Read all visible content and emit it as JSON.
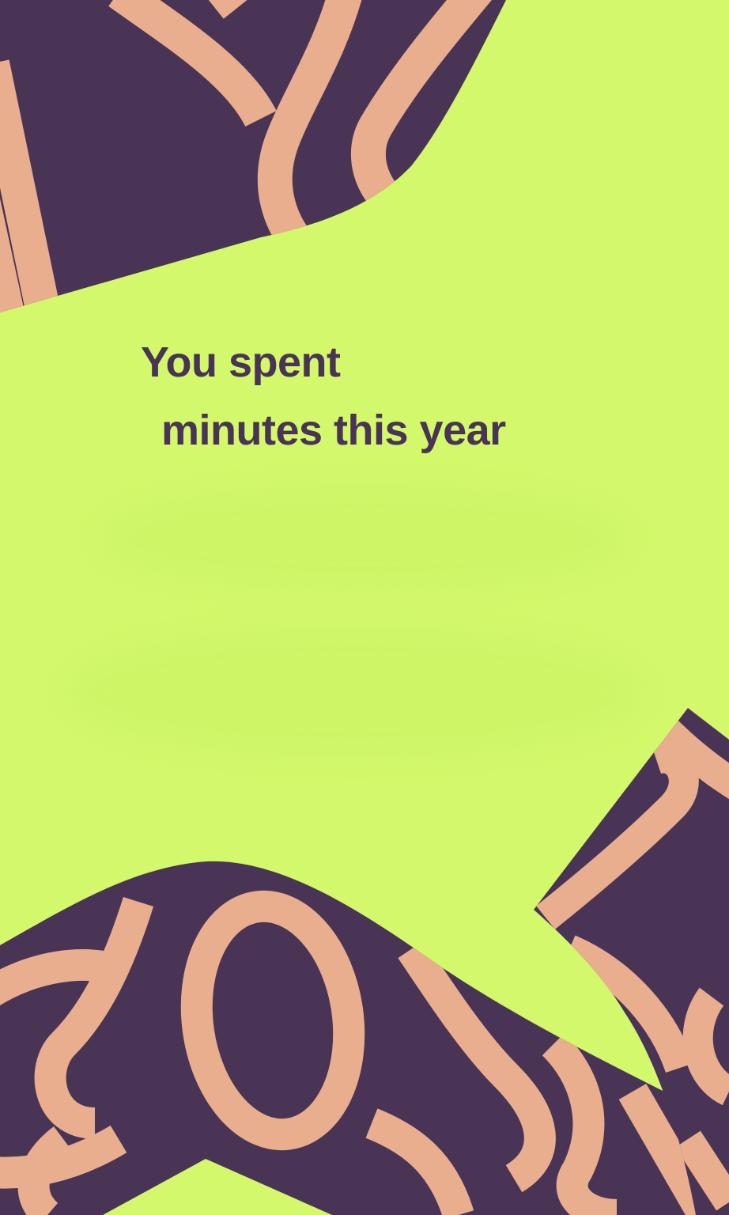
{
  "story": {
    "headline_line1": "You spent",
    "headline_line2": "minutes this year"
  },
  "colors": {
    "background": "#d3f86b",
    "purple": "#4a3456",
    "peach": "#e9ae8d"
  }
}
